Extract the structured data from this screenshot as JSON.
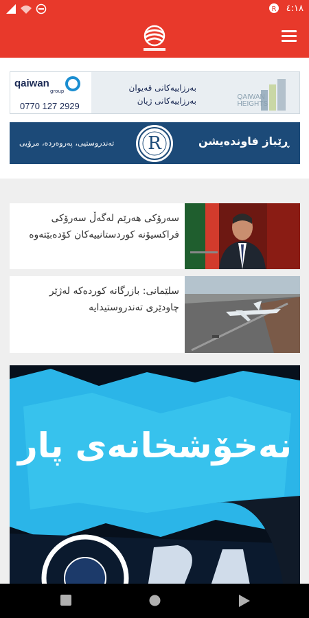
{
  "status_bar": {
    "time": "٤:١٨"
  },
  "app": {
    "logo": "Rudaw"
  },
  "ads": [
    {
      "brand": "qaiwan",
      "brand_sub": "group",
      "phone": "0770 127 2929",
      "line1": "بەرزاییەکانی قەیوان",
      "line2": "بەرزاییەکانی ژیان",
      "project_name": "QAIWAN",
      "project_sub": "HEIGHTS"
    },
    {
      "emblem_letter": "R",
      "name": "ڕێباز فاوندەیشن",
      "tagline": "تەندروستیی، پەروەردە، مرۆیی"
    }
  ],
  "news": [
    {
      "title": "سەرۆکی هەرێم لەگەڵ سەرۆکی فراکسیۆنە کوردستانییەکان کۆدەبێتەوە"
    },
    {
      "title": "سلێمانی: بازرگانە کوردەکە لەژێر چاودێری تەندروستیدایە"
    }
  ],
  "feature": {
    "title": "نەخۆشخانەی پار"
  },
  "colors": {
    "primary": "#e8392b",
    "ad_blue": "#1c4a78",
    "nav": "#000000"
  },
  "icons": [
    "signal-icon",
    "wifi-icon",
    "dnd-icon",
    "notification-icon",
    "menu-icon",
    "back-icon",
    "home-icon",
    "recents-icon"
  ]
}
